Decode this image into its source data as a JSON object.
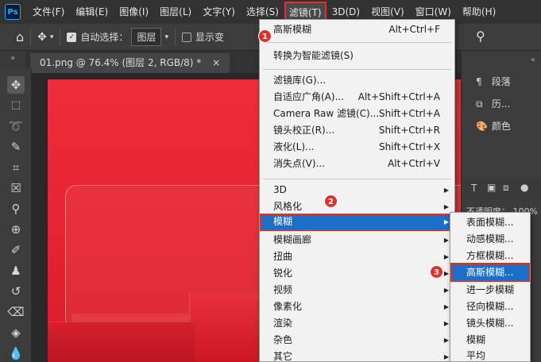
{
  "menubar": {
    "logo": "Ps",
    "items": [
      "文件(F)",
      "编辑(E)",
      "图像(I)",
      "图层(L)",
      "文字(Y)",
      "选择(S)",
      "滤镜(T)",
      "3D(D)",
      "视图(V)",
      "窗口(W)",
      "帮助(H)"
    ],
    "active_index": 6
  },
  "options": {
    "auto_select_label": "自动选择：",
    "auto_select_value": "图层",
    "show_transform_label": "显示变"
  },
  "document_tab": {
    "title": "01.png @ 76.4% (图层 2, RGB/8) *",
    "close": "×"
  },
  "filter_menu": {
    "items": [
      {
        "label": "高斯模糊",
        "shortcut": "Alt+Ctrl+F"
      },
      {
        "label": "转换为智能滤镜(S)",
        "shortcut": ""
      },
      {
        "label": "滤镜库(G)...",
        "shortcut": ""
      },
      {
        "label": "自适应广角(A)...",
        "shortcut": "Alt+Shift+Ctrl+A"
      },
      {
        "label": "Camera Raw 滤镜(C)...",
        "shortcut": "Shift+Ctrl+A"
      },
      {
        "label": "镜头校正(R)...",
        "shortcut": "Shift+Ctrl+R"
      },
      {
        "label": "液化(L)...",
        "shortcut": "Shift+Ctrl+X"
      },
      {
        "label": "消失点(V)...",
        "shortcut": "Alt+Ctrl+V"
      },
      {
        "label": "3D",
        "shortcut": ""
      },
      {
        "label": "风格化",
        "shortcut": ""
      },
      {
        "label": "模糊",
        "shortcut": ""
      },
      {
        "label": "模糊画廊",
        "shortcut": ""
      },
      {
        "label": "扭曲",
        "shortcut": ""
      },
      {
        "label": "锐化",
        "shortcut": ""
      },
      {
        "label": "视频",
        "shortcut": ""
      },
      {
        "label": "像素化",
        "shortcut": ""
      },
      {
        "label": "渲染",
        "shortcut": ""
      },
      {
        "label": "杂色",
        "shortcut": ""
      },
      {
        "label": "其它",
        "shortcut": ""
      }
    ]
  },
  "blur_submenu": {
    "items": [
      "表面模糊...",
      "动感模糊...",
      "方框模糊...",
      "高斯模糊...",
      "进一步模糊",
      "径向模糊...",
      "镜头模糊...",
      "模糊",
      "平均"
    ]
  },
  "right_panel": {
    "paragraph": "段落",
    "history": "历...",
    "color": "颜色",
    "opacity_label": "不透明度：",
    "opacity_value": "100%"
  },
  "badges": [
    "1",
    "2",
    "3"
  ]
}
